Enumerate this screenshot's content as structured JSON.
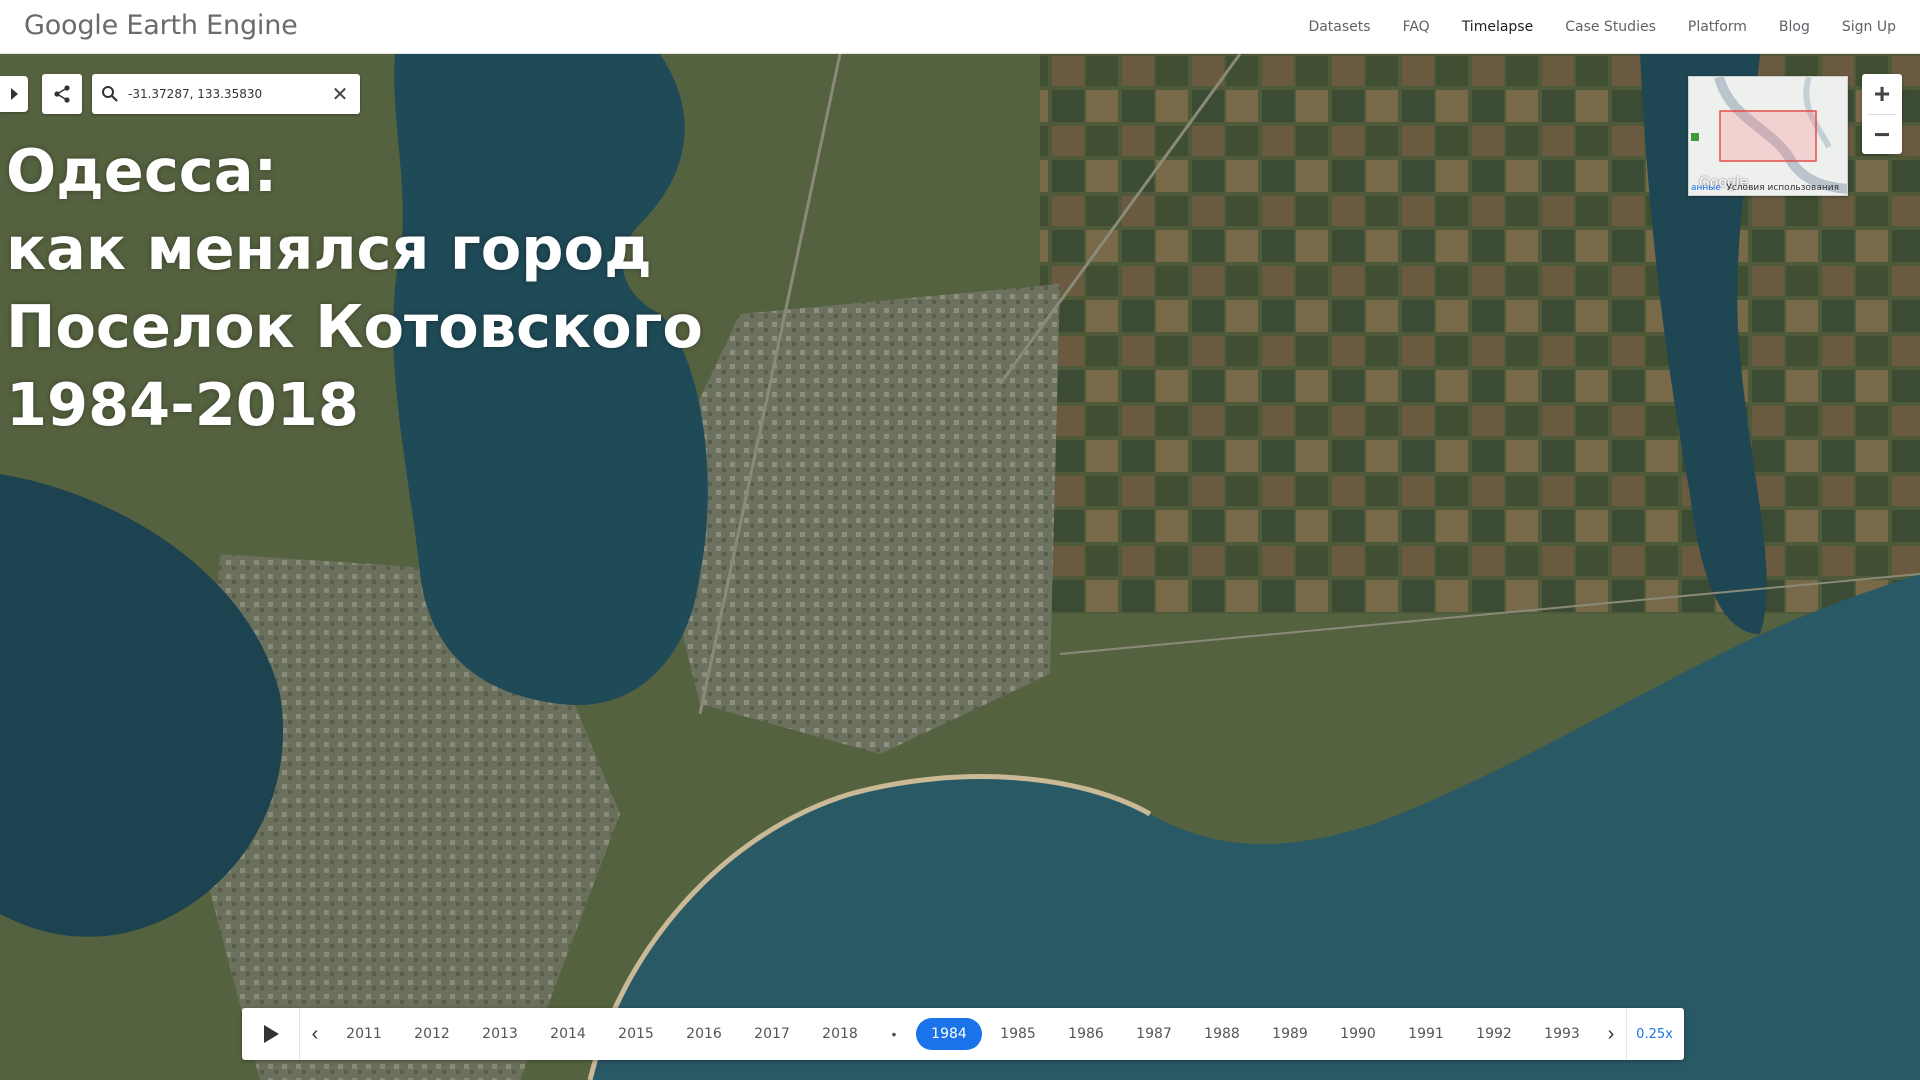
{
  "header": {
    "logo": "Google Earth Engine",
    "nav": [
      "Datasets",
      "FAQ",
      "Timelapse",
      "Case Studies",
      "Platform",
      "Blog",
      "Sign Up"
    ],
    "active": "Timelapse"
  },
  "search": {
    "value": "-31.37287, 133.35830"
  },
  "overlay": {
    "lines": [
      "Одесса:",
      "как менялся город",
      "Поселок Котовского",
      "1984-2018"
    ]
  },
  "minimap": {
    "google_label": "Google",
    "data_link": "анные",
    "terms": "Условия использования"
  },
  "zoom": {
    "in": "+",
    "out": "−"
  },
  "timeline": {
    "years_before": [
      "2011",
      "2012",
      "2013",
      "2014",
      "2015",
      "2016",
      "2017",
      "2018"
    ],
    "separator": "•",
    "selected_year": "1984",
    "years_after": [
      "1985",
      "1986",
      "1987",
      "1988",
      "1989",
      "1990",
      "1991",
      "1992",
      "1993"
    ],
    "speed": "0.25x"
  },
  "colors": {
    "water_dark": "#1f4654",
    "sea": "#2a5a66",
    "land": "#5a6a45",
    "accent": "#1a73e8"
  }
}
